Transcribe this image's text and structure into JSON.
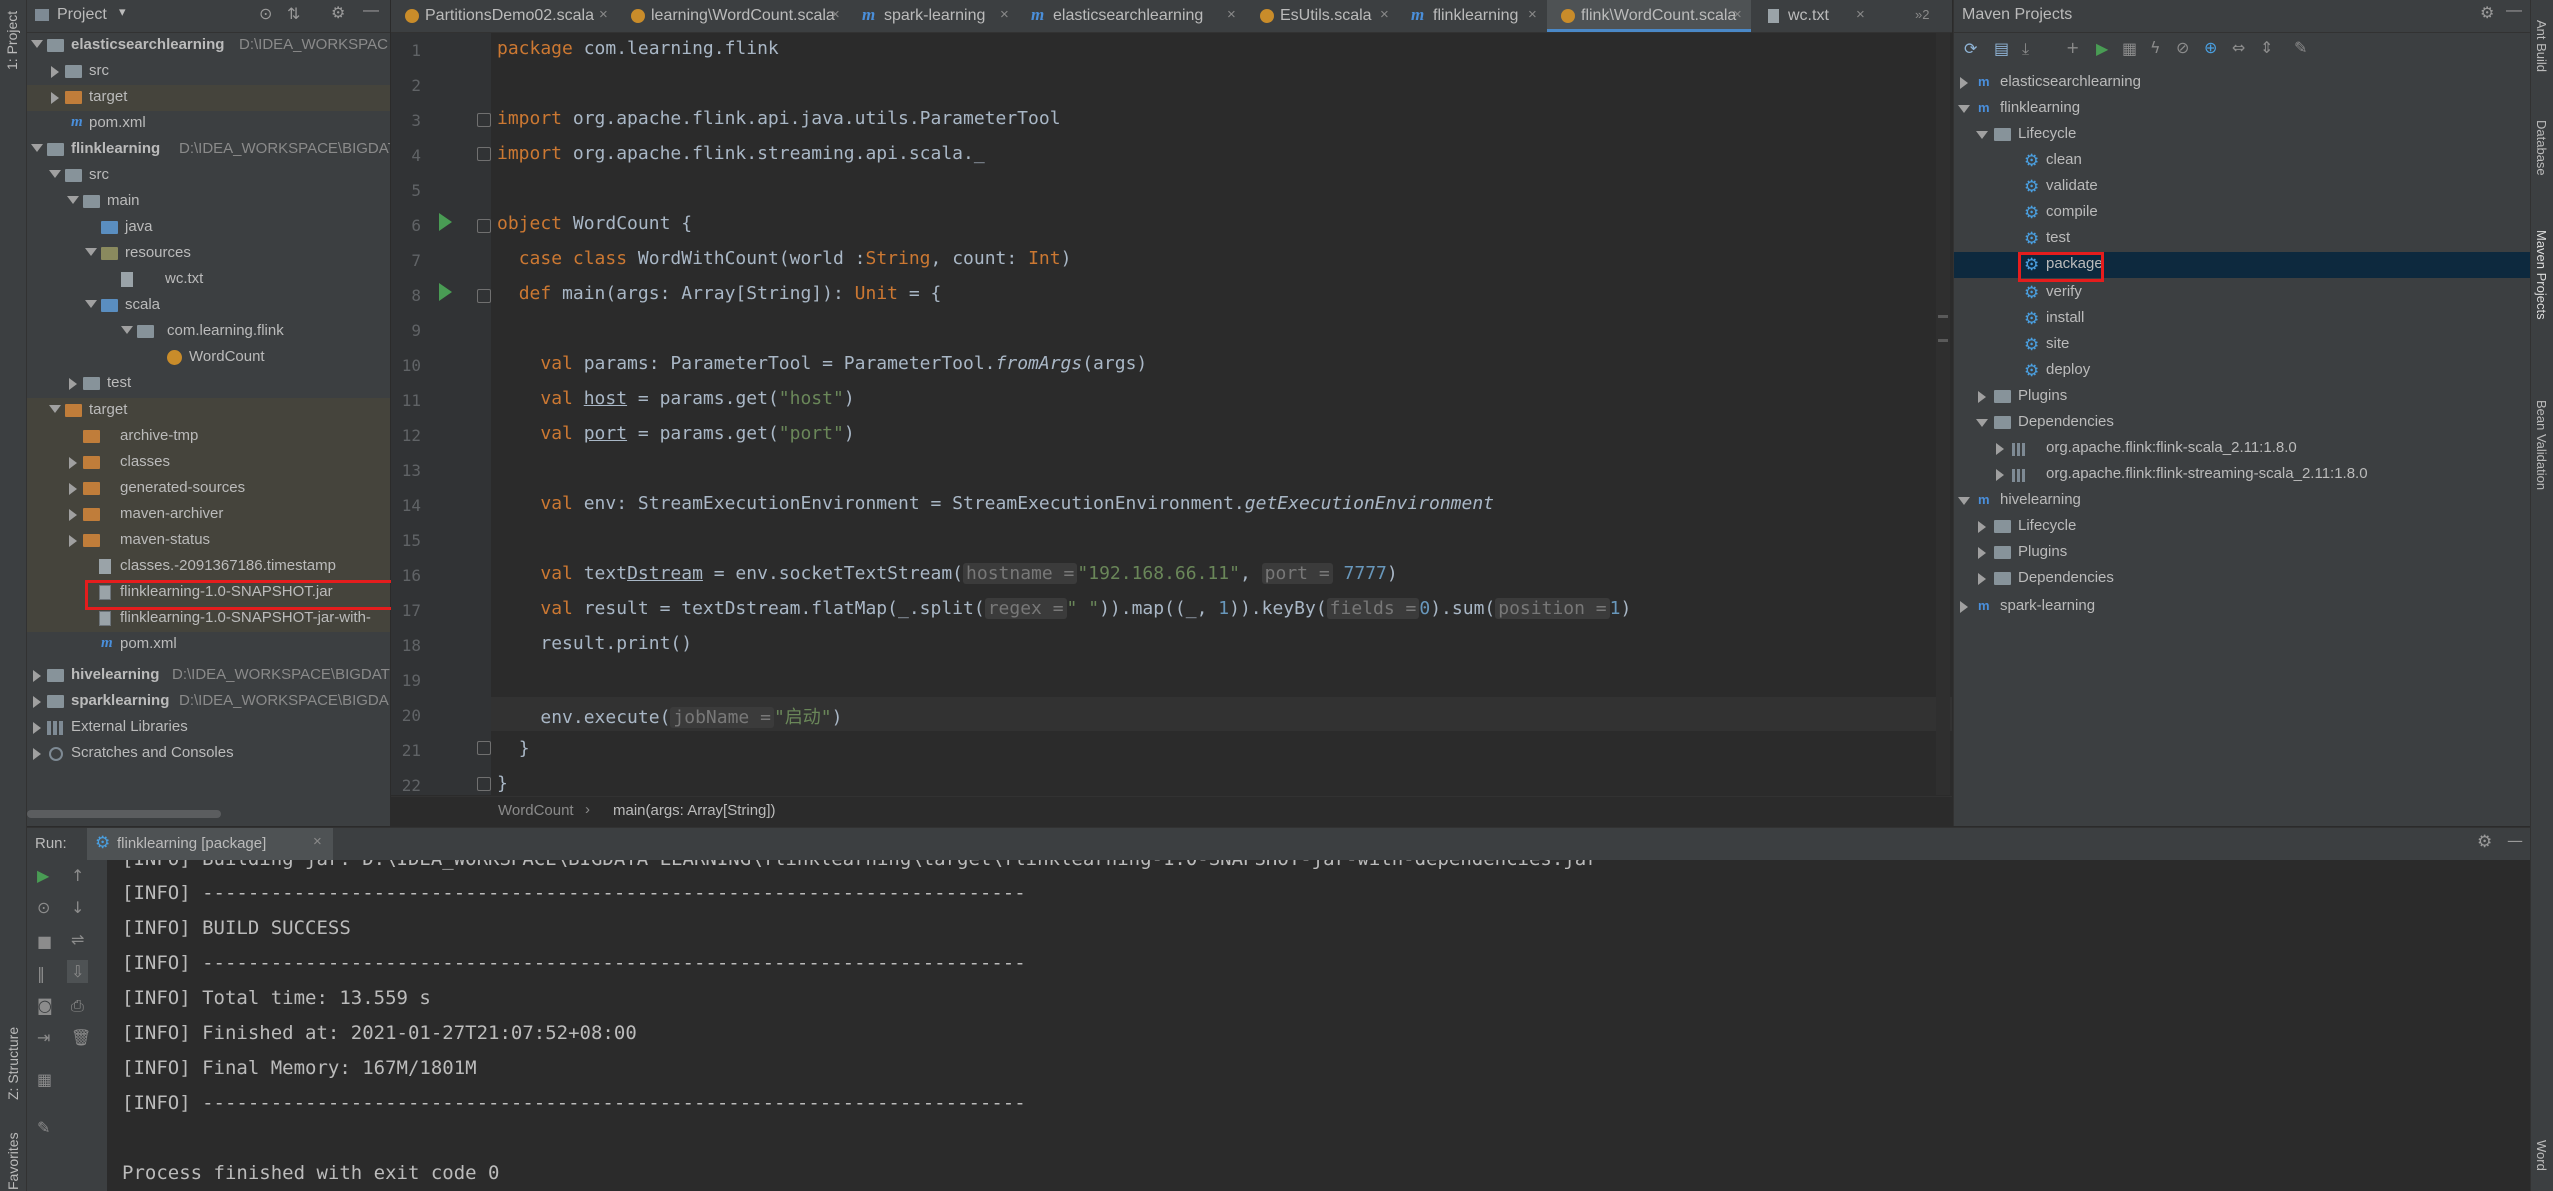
{
  "left_strip": {
    "project_label": "1: Project",
    "structure_label": "Z: Structure",
    "favorites_label": "Favorites"
  },
  "right_strip": {
    "ant_label": "Ant Build",
    "database_label": "Database",
    "maven_label": "Maven Projects",
    "bean_label": "Bean Validation",
    "word_label": "Word"
  },
  "project": {
    "header": "Project",
    "tree": [
      {
        "label": "elasticsearchlearning",
        "path": "D:\\IDEA_WORKSPAC",
        "bold": true
      },
      {
        "label": "src"
      },
      {
        "label": "target"
      },
      {
        "label": "pom.xml"
      },
      {
        "label": "flinklearning",
        "path": "D:\\IDEA_WORKSPACE\\BIGDAT",
        "bold": true
      },
      {
        "label": "src"
      },
      {
        "label": "main"
      },
      {
        "label": "java"
      },
      {
        "label": "resources"
      },
      {
        "label": "wc.txt"
      },
      {
        "label": "scala"
      },
      {
        "label": "com.learning.flink"
      },
      {
        "label": "WordCount"
      },
      {
        "label": "test"
      },
      {
        "label": "target"
      },
      {
        "label": "archive-tmp"
      },
      {
        "label": "classes"
      },
      {
        "label": "generated-sources"
      },
      {
        "label": "maven-archiver"
      },
      {
        "label": "maven-status"
      },
      {
        "label": "classes.-2091367186.timestamp"
      },
      {
        "label": "flinklearning-1.0-SNAPSHOT.jar"
      },
      {
        "label": "flinklearning-1.0-SNAPSHOT-jar-with-"
      },
      {
        "label": "pom.xml"
      },
      {
        "label": "hivelearning",
        "path": "D:\\IDEA_WORKSPACE\\BIGDAT",
        "bold": true
      },
      {
        "label": "sparklearning",
        "path": "D:\\IDEA_WORKSPACE\\BIGDA",
        "bold": true
      },
      {
        "label": "External Libraries"
      },
      {
        "label": "Scratches and Consoles"
      }
    ]
  },
  "tabs": [
    {
      "label": "PartitionsDemo02.scala"
    },
    {
      "label": "learning\\WordCount.scala"
    },
    {
      "label": "spark-learning"
    },
    {
      "label": "elasticsearchlearning"
    },
    {
      "label": "EsUtils.scala"
    },
    {
      "label": "flinklearning"
    },
    {
      "label": "flink\\WordCount.scala"
    },
    {
      "label": "wc.txt"
    }
  ],
  "tabs_overflow": "2",
  "editor": {
    "line_numbers": [
      "1",
      "2",
      "3",
      "4",
      "5",
      "6",
      "7",
      "8",
      "9",
      "10",
      "11",
      "12",
      "13",
      "14",
      "15",
      "16",
      "17",
      "18",
      "19",
      "20",
      "21",
      "22"
    ],
    "code": {
      "l1_kw": "package",
      "l1": " com.learning.flink",
      "l3_kw": "import",
      "l3": " org.apache.flink.api.java.utils.ParameterTool",
      "l4_kw": "import",
      "l4": " org.apache.flink.streaming.api.scala._",
      "l6_kw": "object",
      "l6": " WordCount {",
      "l7_kw1": "case class",
      "l7a": " WordWithCount(world :",
      "l7_t1": "String",
      "l7b": ", count: ",
      "l7_t2": "Int",
      "l7c": ")",
      "l8_kw": "def",
      "l8a": " main(args: Array[String]): ",
      "l8_t": "Unit",
      "l8b": " = {",
      "l10_kw": "val",
      "l10a": " params: ParameterTool = ParameterTool.",
      "l10_it": "fromArgs",
      "l10b": "(args)",
      "l11_kw": "val",
      "l11_v": "host",
      "l11a": " = params.get(",
      "l11_s": "\"host\"",
      "l11b": ")",
      "l12_kw": "val",
      "l12_v": "port",
      "l12a": " = params.get(",
      "l12_s": "\"port\"",
      "l12b": ")",
      "l14_kw": "val",
      "l14a": " env: StreamExecutionEnvironment = StreamExecutionEnvironment.",
      "l14_it": "getExecutionEnvironment",
      "l16_kw": "val",
      "l16a": " text",
      "l16_v": "Dstream",
      "l16b": " = env.socketTextStream(",
      "l16_h1": "hostname =",
      "l16_s": "\"192.168.66.11\"",
      "l16c": ", ",
      "l16_h2": "port =",
      "l16_n": "7777",
      "l16d": ")",
      "l17_kw": "val",
      "l17a": " result = textDstream.flatMap(_.split(",
      "l17_h1": "regex =",
      "l17_s": "\" \"",
      "l17b": ")).map((_, ",
      "l17_n1": "1",
      "l17c": ")).keyBy(",
      "l17_h2": "fields =",
      "l17_n2": "0",
      "l17d": ").sum(",
      "l17_h3": "position =",
      "l17_n3": "1",
      "l17e": ")",
      "l18": "result.print()",
      "l20a": "env.execute(",
      "l20_h": "jobName =",
      "l20_s": "\"启动\"",
      "l20b": ")",
      "l21": "}",
      "l22": "}"
    }
  },
  "breadcrumb": {
    "item1": "WordCount",
    "item2": "main(args: Array[String])"
  },
  "maven": {
    "header": "Maven Projects",
    "rows": [
      {
        "label": "elasticsearchlearning"
      },
      {
        "label": "flinklearning"
      },
      {
        "label": "Lifecycle"
      },
      {
        "label": "clean"
      },
      {
        "label": "validate"
      },
      {
        "label": "compile"
      },
      {
        "label": "test"
      },
      {
        "label": "package"
      },
      {
        "label": "verify"
      },
      {
        "label": "install"
      },
      {
        "label": "site"
      },
      {
        "label": "deploy"
      },
      {
        "label": "Plugins"
      },
      {
        "label": "Dependencies"
      },
      {
        "label": "org.apache.flink:flink-scala_2.11:1.8.0"
      },
      {
        "label": "org.apache.flink:flink-streaming-scala_2.11:1.8.0"
      },
      {
        "label": "hivelearning"
      },
      {
        "label": "Lifecycle"
      },
      {
        "label": "Plugins"
      },
      {
        "label": "Dependencies"
      },
      {
        "label": "spark-learning"
      }
    ]
  },
  "run": {
    "label": "Run:",
    "tab": "flinklearning [package]",
    "console": [
      "[INFO] Building jar: D:\\IDEA_WORKSPACE\\BIGDATA LEARNING\\flinklearning\\target\\flinklearning-1.0-SNAPSHOT-jar-with-dependencies.jar",
      "[INFO] ------------------------------------------------------------------------",
      "[INFO] BUILD SUCCESS",
      "[INFO] ------------------------------------------------------------------------",
      "[INFO] Total time: 13.559 s",
      "[INFO] Finished at: 2021-01-27T21:07:52+08:00",
      "[INFO] Final Memory: 167M/1801M",
      "[INFO] ------------------------------------------------------------------------",
      "",
      "Process finished with exit code 0"
    ]
  },
  "colors": {
    "keyword": "#cc7832",
    "string": "#6a8759",
    "number": "#6897bb",
    "highlight_box": "#e51d1d",
    "maven_selection": "#0d293e"
  }
}
